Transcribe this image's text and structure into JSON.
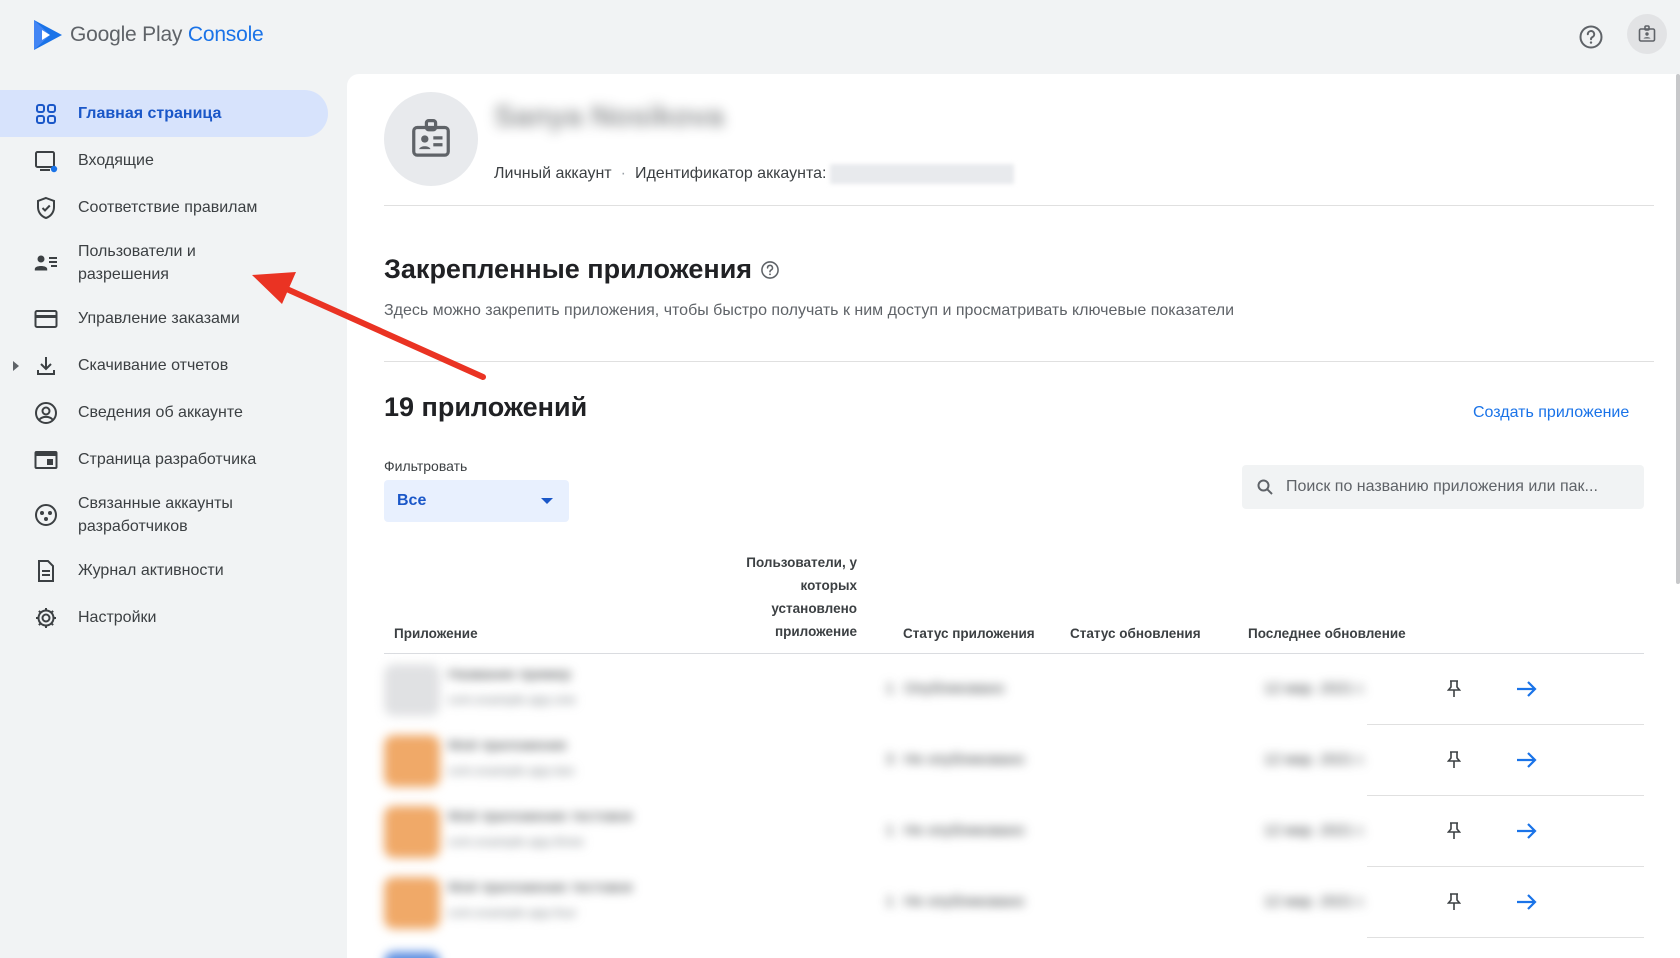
{
  "brand": {
    "google": "Google",
    "play": "Play",
    "console": "Console",
    "accent": "#1a73e8"
  },
  "header": {
    "help_icon": "help-circle-icon",
    "account_icon": "badge-icon"
  },
  "sidebar": {
    "items": [
      {
        "label": "Главная страница",
        "icon": "dashboard-grid-icon",
        "active": true
      },
      {
        "label": "Входящие",
        "icon": "inbox-icon"
      },
      {
        "label": "Соответствие правилам",
        "icon": "shield-check-icon"
      },
      {
        "label": "Пользователи и\nразрешения",
        "icon": "users-permissions-icon"
      },
      {
        "label": "Управление заказами",
        "icon": "credit-card-icon"
      },
      {
        "label": "Скачивание отчетов",
        "icon": "download-icon",
        "expandable": true
      },
      {
        "label": "Сведения об аккаунте",
        "icon": "account-circle-icon"
      },
      {
        "label": "Страница разработчика",
        "icon": "developer-page-icon"
      },
      {
        "label": "Связанные аккаунты\nразработчиков",
        "icon": "linked-accounts-icon"
      },
      {
        "label": "Журнал активности",
        "icon": "document-icon"
      },
      {
        "label": "Настройки",
        "icon": "settings-gear-icon"
      }
    ]
  },
  "profile": {
    "name": "Sanya Nosikova",
    "account_type": "Личный аккаунт",
    "account_id_label": "Идентификатор аккаунта:"
  },
  "pinned": {
    "title": "Закрепленные приложения",
    "description": "Здесь можно закрепить приложения, чтобы быстро получать к ним доступ и просматривать ключевые показатели"
  },
  "apps": {
    "count_label": "19 приложений",
    "create_label": "Создать приложение",
    "filter_label": "Фильтровать",
    "filter_value": "Все",
    "search_placeholder": "Поиск по названию приложения или пак..."
  },
  "table": {
    "columns": {
      "app": "Приложение",
      "users": "Пользователи, у\nкоторых\nустановлено\nприложение",
      "status": "Статус приложения",
      "update_status": "Статус обновления",
      "last_update": "Последнее обновление"
    },
    "rows": [
      {
        "name": "Название пример",
        "package": "com.example.app.one",
        "users": "1",
        "status": "Опубликовано",
        "last_update": "12 мар. 2021 г.",
        "icon_color": "#e8eaed"
      },
      {
        "name": "Моё приложение",
        "package": "com.example.app.two",
        "users": "3",
        "status": "Не опубликовано",
        "last_update": "12 мар. 2021 г.",
        "icon_color": "#f0a968"
      },
      {
        "name": "Моё приложение тестовое",
        "package": "com.example.app.three",
        "users": "1",
        "status": "Не опубликовано",
        "last_update": "12 мар. 2021 г.",
        "icon_color": "#f0a968"
      },
      {
        "name": "Моё приложение тестовое",
        "package": "com.example.app.four",
        "users": "1",
        "status": "Не опубликовано",
        "last_update": "12 мар. 2021 г.",
        "icon_color": "#f0a968"
      }
    ]
  },
  "colors": {
    "active_bg": "#d7e3fc",
    "active_text": "#1a57c8",
    "annotation_arrow": "#ea3323"
  }
}
